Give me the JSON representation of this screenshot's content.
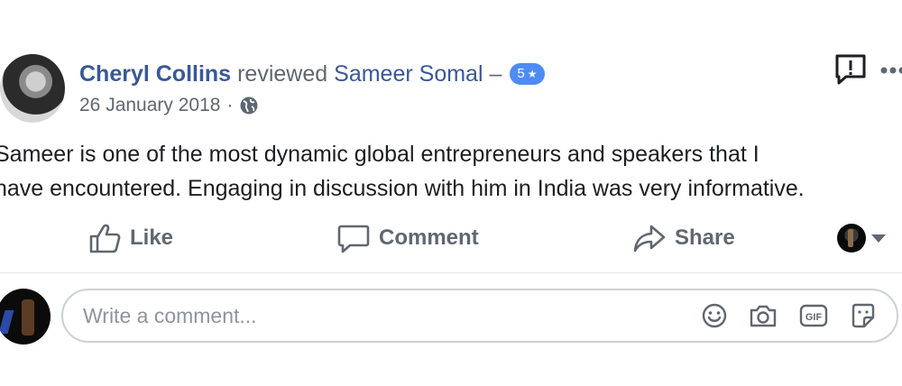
{
  "post": {
    "author_name": "Cheryl Collins",
    "action_text": "reviewed",
    "page_name": "Sameer Somal",
    "dash": "–",
    "rating_value": "5",
    "rating_star": "★",
    "date": "26 January 2018",
    "meta_separator": "·",
    "privacy_icon": "globe-icon",
    "text_lines": [
      "Sameer is one of the most dynamic global entrepreneurs and speakers that I",
      "have encountered. Engaging in discussion with him in India was very informative."
    ]
  },
  "actions": {
    "like_label": "Like",
    "comment_label": "Comment",
    "share_label": "Share"
  },
  "comment_box": {
    "placeholder": "Write a comment...",
    "icons": [
      "emoji-icon",
      "camera-icon",
      "gif-icon",
      "sticker-icon"
    ]
  },
  "colors": {
    "link": "#385898",
    "muted": "#606770",
    "badge": "#4e8cf5",
    "border": "#ccd0d5"
  }
}
